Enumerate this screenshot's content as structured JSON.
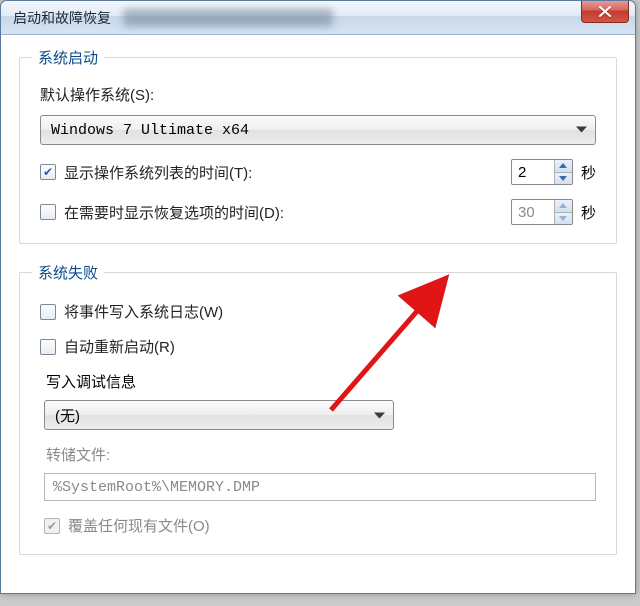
{
  "window": {
    "title": "启动和故障恢复"
  },
  "startup": {
    "group_title": "系统启动",
    "default_os_label": "默认操作系统(S):",
    "default_os_value": "Windows 7 Ultimate x64",
    "show_os_list": {
      "checked": true,
      "label": "显示操作系统列表的时间(T):",
      "value": "2",
      "unit": "秒"
    },
    "show_recovery": {
      "checked": false,
      "label": "在需要时显示恢复选项的时间(D):",
      "value": "30",
      "unit": "秒"
    }
  },
  "failure": {
    "group_title": "系统失败",
    "write_event": {
      "checked": false,
      "label": "将事件写入系统日志(W)"
    },
    "auto_restart": {
      "checked": false,
      "label": "自动重新启动(R)"
    },
    "debug_info_label": "写入调试信息",
    "debug_info_value": "(无)",
    "dump_file_label": "转储文件:",
    "dump_file_value": "%SystemRoot%\\MEMORY.DMP",
    "overwrite": {
      "checked": true,
      "label": "覆盖任何现有文件(O)"
    }
  }
}
